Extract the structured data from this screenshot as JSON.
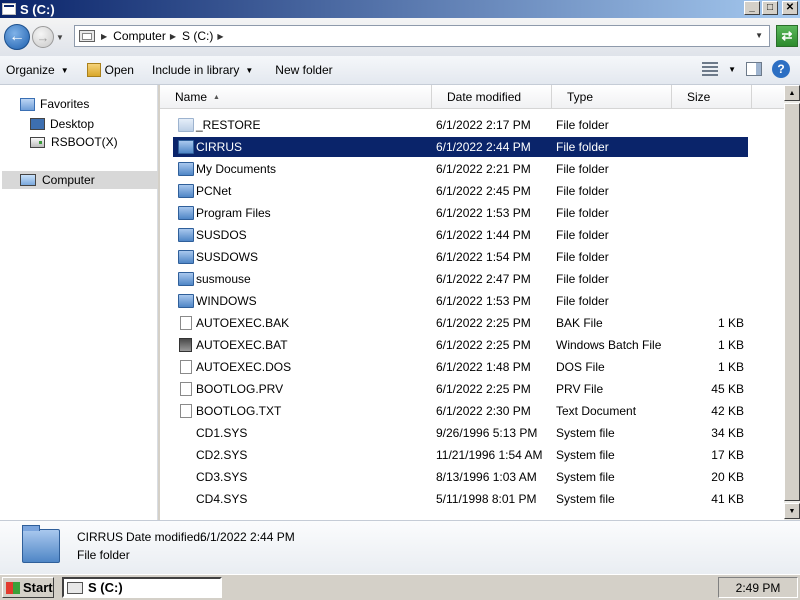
{
  "window": {
    "title": "S (C:)"
  },
  "address": {
    "crumbs": [
      "Computer",
      "S (C:)"
    ]
  },
  "toolbar": {
    "organize": "Organize",
    "open": "Open",
    "include_in_library": "Include in library",
    "new_folder": "New folder"
  },
  "nav": {
    "favorites": "Favorites",
    "desktop": "Desktop",
    "rsboot": "RSBOOT(X)",
    "computer": "Computer"
  },
  "columns": {
    "name": "Name",
    "date_modified": "Date modified",
    "type": "Type",
    "size": "Size"
  },
  "files": [
    {
      "name": "_RESTORE",
      "date": "6/1/2022 2:17 PM",
      "type": "File folder",
      "size": "",
      "icon": "folder-ghost-icon"
    },
    {
      "name": "CIRRUS",
      "date": "6/1/2022 2:44 PM",
      "type": "File folder",
      "size": "",
      "icon": "folder-icon",
      "selected": true
    },
    {
      "name": "My Documents",
      "date": "6/1/2022 2:21 PM",
      "type": "File folder",
      "size": "",
      "icon": "folder-icon"
    },
    {
      "name": "PCNet",
      "date": "6/1/2022 2:45 PM",
      "type": "File folder",
      "size": "",
      "icon": "folder-icon"
    },
    {
      "name": "Program Files",
      "date": "6/1/2022 1:53 PM",
      "type": "File folder",
      "size": "",
      "icon": "folder-icon"
    },
    {
      "name": "SUSDOS",
      "date": "6/1/2022 1:44 PM",
      "type": "File folder",
      "size": "",
      "icon": "folder-icon"
    },
    {
      "name": "SUSDOWS",
      "date": "6/1/2022 1:54 PM",
      "type": "File folder",
      "size": "",
      "icon": "folder-icon"
    },
    {
      "name": "susmouse",
      "date": "6/1/2022 2:47 PM",
      "type": "File folder",
      "size": "",
      "icon": "folder-icon"
    },
    {
      "name": "WINDOWS",
      "date": "6/1/2022 1:53 PM",
      "type": "File folder",
      "size": "",
      "icon": "folder-icon"
    },
    {
      "name": "AUTOEXEC.BAK",
      "date": "6/1/2022 2:25 PM",
      "type": "BAK File",
      "size": "1 KB",
      "icon": "file-icon"
    },
    {
      "name": "AUTOEXEC.BAT",
      "date": "6/1/2022 2:25 PM",
      "type": "Windows Batch File",
      "size": "1 KB",
      "icon": "batch-file-icon"
    },
    {
      "name": "AUTOEXEC.DOS",
      "date": "6/1/2022 1:48 PM",
      "type": "DOS File",
      "size": "1 KB",
      "icon": "file-icon"
    },
    {
      "name": "BOOTLOG.PRV",
      "date": "6/1/2022 2:25 PM",
      "type": "PRV File",
      "size": "45 KB",
      "icon": "file-icon"
    },
    {
      "name": "BOOTLOG.TXT",
      "date": "6/1/2022 2:30 PM",
      "type": "Text Document",
      "size": "42 KB",
      "icon": "file-icon"
    },
    {
      "name": "CD1.SYS",
      "date": "9/26/1996 5:13 PM",
      "type": "System file",
      "size": "34 KB",
      "icon": "system-file-icon"
    },
    {
      "name": "CD2.SYS",
      "date": "11/21/1996 1:54 AM",
      "type": "System file",
      "size": "17 KB",
      "icon": "system-file-icon"
    },
    {
      "name": "CD3.SYS",
      "date": "8/13/1996 1:03 AM",
      "type": "System file",
      "size": "20 KB",
      "icon": "system-file-icon"
    },
    {
      "name": "CD4.SYS",
      "date": "5/11/1998 8:01 PM",
      "type": "System file",
      "size": "41 KB",
      "icon": "system-file-icon"
    }
  ],
  "details": {
    "name": "CIRRUS",
    "date_label": "Date modified:",
    "date_value": "6/1/2022 2:44 PM",
    "type": "File folder"
  },
  "taskbar": {
    "start": "Start",
    "task": "S (C:)",
    "clock": "2:49 PM"
  },
  "colors": {
    "selection": "#0a246a",
    "titlebar_start": "#0a246a",
    "titlebar_end": "#a6caf0"
  }
}
